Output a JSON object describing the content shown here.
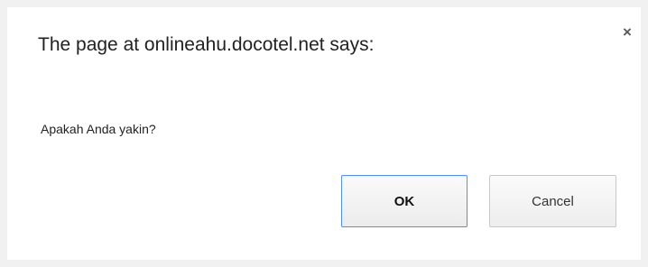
{
  "dialog": {
    "title": "The page at onlineahu.docotel.net says:",
    "message": "Apakah Anda yakin?",
    "close_glyph": "×",
    "close_icon": "close-icon",
    "ok_label": "OK",
    "cancel_label": "Cancel"
  },
  "colors": {
    "focus_border": "#4d90fe",
    "background": "#ffffff"
  }
}
